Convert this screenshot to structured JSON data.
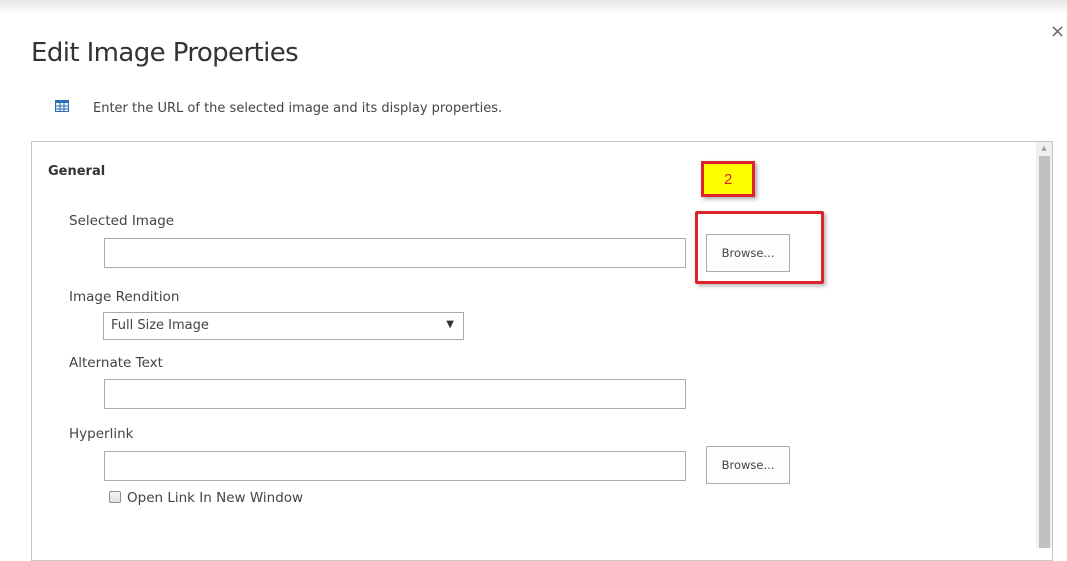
{
  "dialog": {
    "title": "Edit Image Properties",
    "close_symbol": "×",
    "description": "Enter the URL of the selected image and its display properties.",
    "description_icon": "table-icon"
  },
  "general": {
    "heading": "General",
    "selected_image": {
      "label": "Selected Image",
      "value": "",
      "browse_label": "Browse..."
    },
    "image_rendition": {
      "label": "Image Rendition",
      "selected": "Full Size Image"
    },
    "alternate_text": {
      "label": "Alternate Text",
      "value": ""
    },
    "hyperlink": {
      "label": "Hyperlink",
      "value": "",
      "browse_label": "Browse..."
    },
    "open_new_window": {
      "label": "Open Link In New Window",
      "checked": false
    }
  },
  "annotation": {
    "step_number": "2",
    "color": "#e0222a",
    "badge_fill": "#ffff00"
  }
}
